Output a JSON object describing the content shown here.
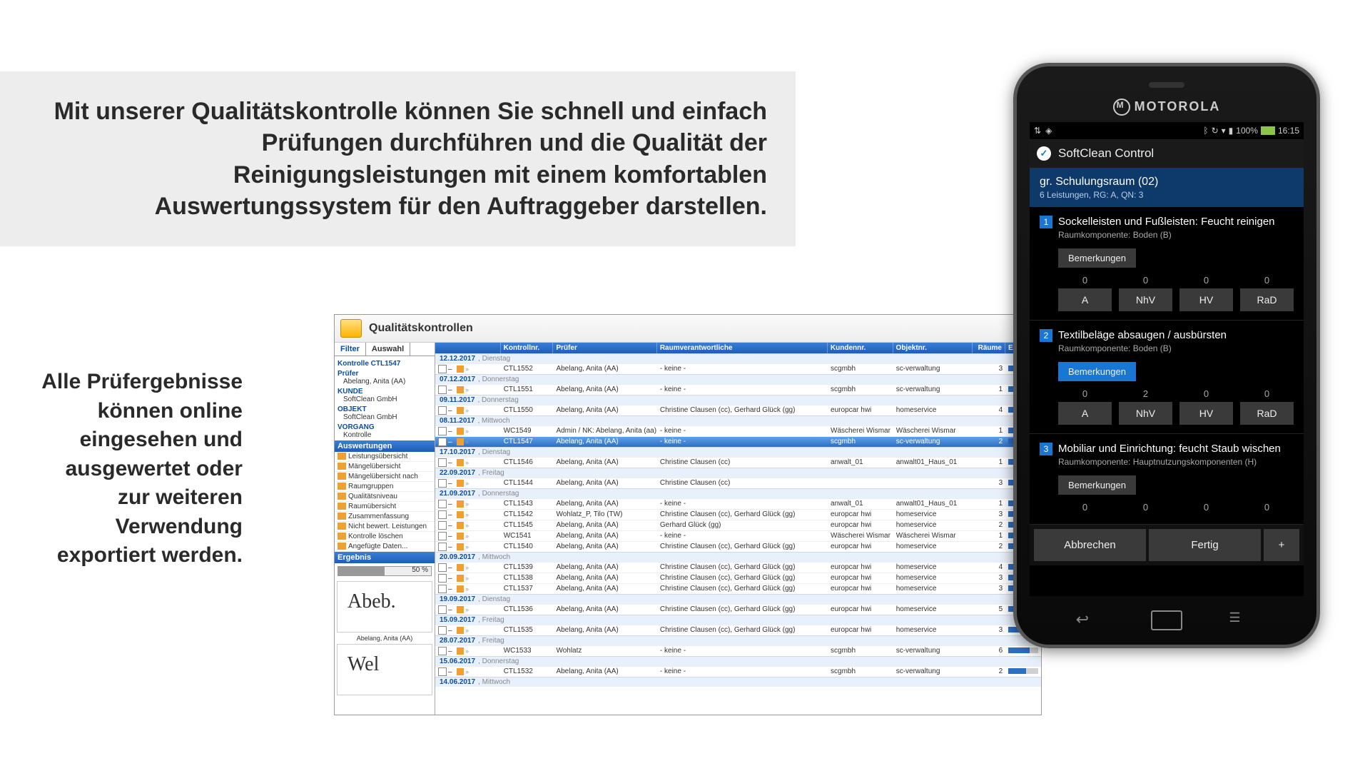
{
  "hero": "Mit unserer Qualitätskontrolle können Sie schnell und einfach Prüfungen durchführen und die Qualität der Reinigungsleistungen mit einem komfortablen Auswertungssystem für den Auftraggeber darstellen.",
  "side": "Alle Prüfergebnisse können online eingesehen und ausgewertet oder zur weiteren Verwendung exportiert werden.",
  "app": {
    "title": "Qualitätskontrollen",
    "tabs": [
      "Filter",
      "Auswahl"
    ],
    "sb": {
      "kontrolle": {
        "hdr": "Kontrolle CTL1547"
      },
      "pruefer": {
        "hdr": "Prüfer",
        "val": "Abelang, Anita (AA)"
      },
      "kunde": {
        "hdr": "KUNDE",
        "val": "SoftClean GmbH"
      },
      "objekt": {
        "hdr": "OBJEKT",
        "val": "SoftClean GmbH"
      },
      "vorgang": {
        "hdr": "VORGANG",
        "val": "Kontrolle"
      }
    },
    "ausw": {
      "hdr": "Auswertungen",
      "items": [
        "Leistungsübersicht",
        "Mängelübersicht",
        "Mängelübersicht nach",
        "Raumgruppen",
        "Qualitätsniveau",
        "Raumübersicht",
        "Zusammenfassung",
        "Nicht bewert. Leistungen",
        "Kontrolle löschen",
        "Angefügte Daten..."
      ]
    },
    "erg": {
      "hdr": "Ergebnis",
      "pct": "50 %",
      "fill": 50,
      "sig1": "Abeb.",
      "sig1n": "Abelang, Anita (AA)",
      "sig2": "Wel"
    },
    "cols": {
      "nr": "Kontrollnr.",
      "pr": "Prüfer",
      "rv": "Raumverantwortliche",
      "kd": "Kundennr.",
      "ob": "Objektnr.",
      "rm": "Räume",
      "eg": "Ergebnis"
    },
    "groups": [
      {
        "date": "12.12.2017",
        "dow": "Dienstag",
        "rows": [
          {
            "nr": "CTL1552",
            "pr": "Abelang, Anita (AA)",
            "rv": "- keine -",
            "kd": "scgmbh",
            "ob": "sc-verwaltung",
            "rm": 3,
            "eg": 40
          }
        ]
      },
      {
        "date": "07.12.2017",
        "dow": "Donnerstag",
        "rows": [
          {
            "nr": "CTL1551",
            "pr": "Abelang, Anita (AA)",
            "rv": "- keine -",
            "kd": "scgmbh",
            "ob": "sc-verwaltung",
            "rm": 1,
            "eg": 35
          }
        ]
      },
      {
        "date": "09.11.2017",
        "dow": "Donnerstag",
        "rows": [
          {
            "nr": "CTL1550",
            "pr": "Abelang, Anita (AA)",
            "rv": "Christine Clausen (cc), Gerhard Glück (gg)",
            "kd": "europcar hwi",
            "ob": "homeservice",
            "rm": 4,
            "eg": 75
          }
        ]
      },
      {
        "date": "08.11.2017",
        "dow": "Mittwoch",
        "rows": [
          {
            "nr": "WC1549",
            "pr": "Admin / NK: Abelang, Anita (aa)",
            "rv": "- keine -",
            "kd": "Wäscherei Wismar",
            "ob": "Wäscherei Wismar",
            "rm": 1,
            "eg": 70
          },
          {
            "nr": "CTL1547",
            "pr": "Abelang, Anita (AA)",
            "rv": "- keine -",
            "kd": "scgmbh",
            "ob": "sc-verwaltung",
            "rm": 2,
            "eg": 50,
            "sel": true
          }
        ]
      },
      {
        "date": "17.10.2017",
        "dow": "Dienstag",
        "rows": [
          {
            "nr": "CTL1546",
            "pr": "Abelang, Anita (AA)",
            "rv": "Christine Clausen (cc)",
            "kd": "anwalt_01",
            "ob": "anwalt01_Haus_01",
            "rm": 1,
            "eg": 55
          }
        ]
      },
      {
        "date": "22.09.2017",
        "dow": "Freitag",
        "rows": [
          {
            "nr": "CTL1544",
            "pr": "Abelang, Anita (AA)",
            "rv": "Christine Clausen (cc)",
            "kd": "",
            "ob": "",
            "rm": 3,
            "eg": 60
          }
        ]
      },
      {
        "date": "21.09.2017",
        "dow": "Donnerstag",
        "rows": [
          {
            "nr": "CTL1543",
            "pr": "Abelang, Anita (AA)",
            "rv": "- keine -",
            "kd": "anwalt_01",
            "ob": "anwalt01_Haus_01",
            "rm": 1,
            "eg": 45
          },
          {
            "nr": "CTL1542",
            "pr": "Wohlatz_P, Tilo (TW)",
            "rv": "Christine Clausen (cc), Gerhard Glück (gg)",
            "kd": "europcar hwi",
            "ob": "homeservice",
            "rm": 3,
            "eg": 65
          },
          {
            "nr": "CTL1545",
            "pr": "Abelang, Anita (AA)",
            "rv": "Gerhard Glück (gg)",
            "kd": "europcar hwi",
            "ob": "homeservice",
            "rm": 2,
            "eg": 55
          },
          {
            "nr": "WC1541",
            "pr": "Abelang, Anita (AA)",
            "rv": "- keine -",
            "kd": "Wäscherei Wismar",
            "ob": "Wäscherei Wismar",
            "rm": 1,
            "eg": 60
          },
          {
            "nr": "CTL1540",
            "pr": "Abelang, Anita (AA)",
            "rv": "Christine Clausen (cc), Gerhard Glück (gg)",
            "kd": "europcar hwi",
            "ob": "homeservice",
            "rm": 2,
            "eg": 80
          }
        ]
      },
      {
        "date": "20.09.2017",
        "dow": "Mittwoch",
        "rows": [
          {
            "nr": "CTL1539",
            "pr": "Abelang, Anita (AA)",
            "rv": "Christine Clausen (cc), Gerhard Glück (gg)",
            "kd": "europcar hwi",
            "ob": "homeservice",
            "rm": 4,
            "eg": 70
          },
          {
            "nr": "CTL1538",
            "pr": "Abelang, Anita (AA)",
            "rv": "Christine Clausen (cc), Gerhard Glück (gg)",
            "kd": "europcar hwi",
            "ob": "homeservice",
            "rm": 3,
            "eg": 75
          },
          {
            "nr": "CTL1537",
            "pr": "Abelang, Anita (AA)",
            "rv": "Christine Clausen (cc), Gerhard Glück (gg)",
            "kd": "europcar hwi",
            "ob": "homeservice",
            "rm": 3,
            "eg": 65
          }
        ]
      },
      {
        "date": "19.09.2017",
        "dow": "Dienstag",
        "rows": [
          {
            "nr": "CTL1536",
            "pr": "Abelang, Anita (AA)",
            "rv": "Christine Clausen (cc), Gerhard Glück (gg)",
            "kd": "europcar hwi",
            "ob": "homeservice",
            "rm": 5,
            "eg": 80
          }
        ]
      },
      {
        "date": "15.09.2017",
        "dow": "Freitag",
        "rows": [
          {
            "nr": "CTL1535",
            "pr": "Abelang, Anita (AA)",
            "rv": "Christine Clausen (cc), Gerhard Glück (gg)",
            "kd": "europcar hwi",
            "ob": "homeservice",
            "rm": 3,
            "eg": 55
          }
        ]
      },
      {
        "date": "28.07.2017",
        "dow": "Freitag",
        "rows": [
          {
            "nr": "WC1533",
            "pr": "Wohlatz",
            "rv": "- keine -",
            "kd": "scgmbh",
            "ob": "sc-verwaltung",
            "rm": 6,
            "eg": 70
          }
        ]
      },
      {
        "date": "15.06.2017",
        "dow": "Donnerstag",
        "rows": [
          {
            "nr": "CTL1532",
            "pr": "Abelang, Anita (AA)",
            "rv": "- keine -",
            "kd": "scgmbh",
            "ob": "sc-verwaltung",
            "rm": 2,
            "eg": 60
          }
        ]
      },
      {
        "date": "14.06.2017",
        "dow": "Mittwoch",
        "rows": []
      }
    ]
  },
  "phone": {
    "brand": "MOTOROLA",
    "time": "16:15",
    "signal": "100%",
    "app": "SoftClean Control",
    "room": {
      "title": "gr. Schulungsraum (02)",
      "sub": "6 Leistungen, RG: A, QN: 3"
    },
    "tasks": [
      {
        "n": "1",
        "t": "Sockelleisten und Fußleisten: Feucht reinigen",
        "sub": "Raumkomponente: Boden (B)",
        "bem": "Bemerkungen",
        "bemActive": false,
        "ratings": [
          "A",
          "NhV",
          "HV",
          "RaD"
        ],
        "vals": [
          "0",
          "0",
          "0",
          "0"
        ]
      },
      {
        "n": "2",
        "t": "Textilbeläge absaugen / ausbürsten",
        "sub": "Raumkomponente: Boden (B)",
        "bem": "Bemerkungen",
        "bemActive": true,
        "ratings": [
          "A",
          "NhV",
          "HV",
          "RaD"
        ],
        "vals": [
          "0",
          "2",
          "0",
          "0"
        ]
      },
      {
        "n": "3",
        "t": "Mobiliar und Einrichtung: feucht Staub wischen",
        "sub": "Raumkomponente: Hauptnutzungskomponenten (H)",
        "bem": "Bemerkungen",
        "bemActive": false,
        "ratings": [],
        "vals": [
          "0",
          "0",
          "0",
          "0"
        ]
      }
    ],
    "bottom": {
      "cancel": "Abbrechen",
      "done": "Fertig",
      "plus": "+"
    }
  }
}
